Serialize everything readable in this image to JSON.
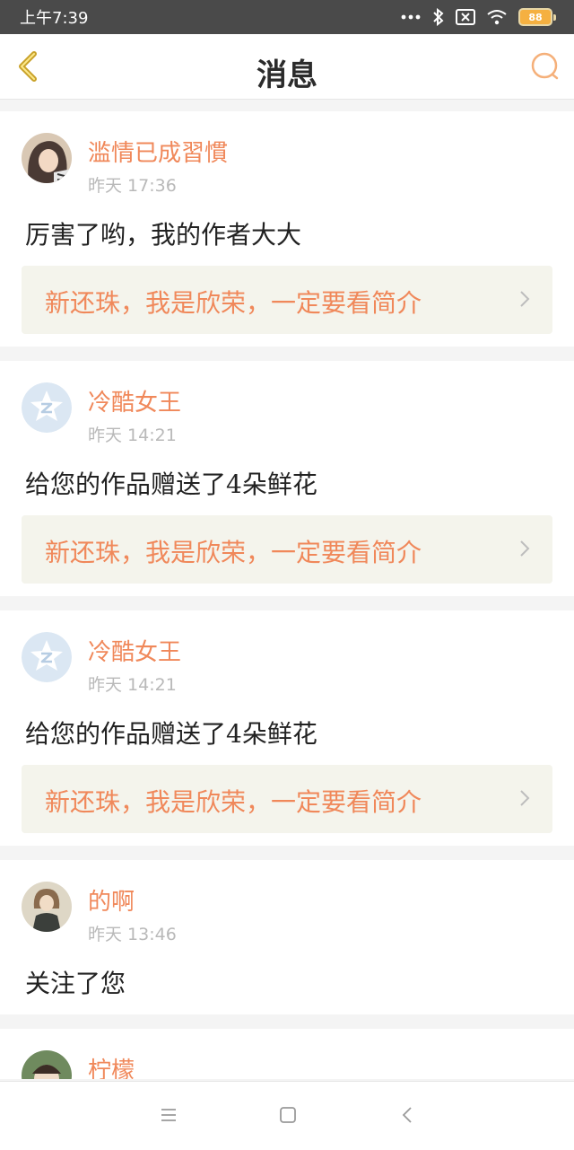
{
  "status": {
    "time": "上午7:39",
    "battery": "88"
  },
  "header": {
    "title": "消息"
  },
  "messages": [
    {
      "name": "滥情已成習慣",
      "time": "昨天 17:36",
      "text": "厉害了哟，我的作者大大",
      "book": "新还珠，我是欣荣，一定要看简介"
    },
    {
      "name": "冷酷女王",
      "time": "昨天 14:21",
      "text": "给您的作品赠送了4朵鲜花",
      "book": "新还珠，我是欣荣，一定要看简介"
    },
    {
      "name": "冷酷女王",
      "time": "昨天 14:21",
      "text": "给您的作品赠送了4朵鲜花",
      "book": "新还珠，我是欣荣，一定要看简介"
    },
    {
      "name": "的啊",
      "time": "昨天 13:46",
      "text": "关注了您"
    },
    {
      "name": "柠檬"
    }
  ],
  "colors": {
    "accent": "#f0885a",
    "statusbar": "#4a4a4a",
    "book_bg": "#f4f4ec"
  }
}
